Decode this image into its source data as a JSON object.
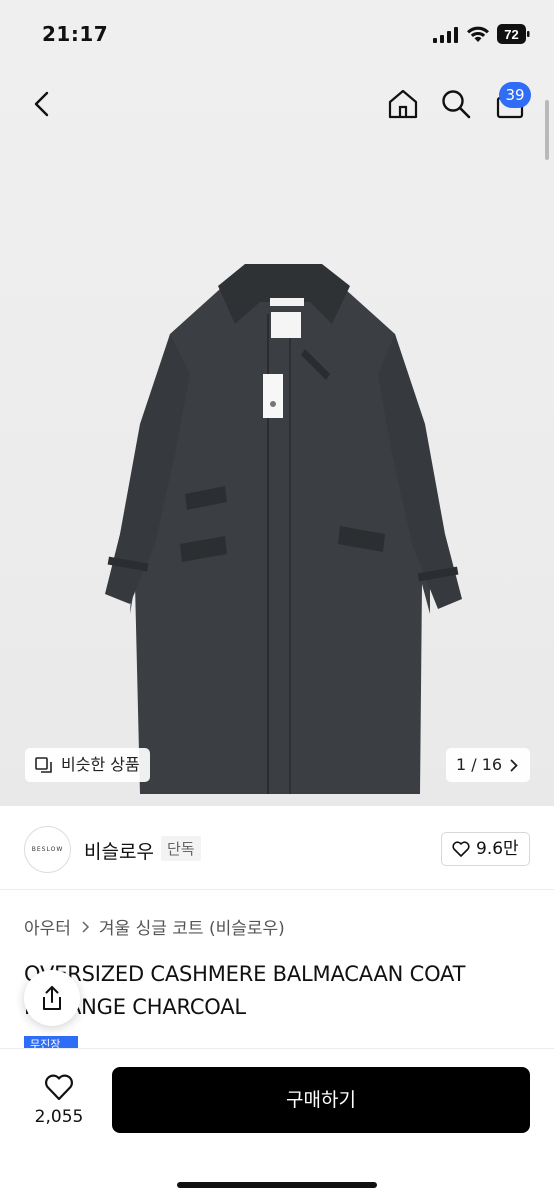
{
  "status_bar": {
    "time": "21:17",
    "battery": "72"
  },
  "header": {
    "cart_count": "39"
  },
  "gallery": {
    "similar_label": "비슷한 상품",
    "counter": "1 / 16",
    "coat_color": "#3a3d40"
  },
  "brand": {
    "name": "비슬로우",
    "tag": "단독",
    "likes": "9.6만",
    "logo_text": "BESLOW"
  },
  "breadcrumb": {
    "category": "아우터",
    "subcategory": "겨울 싱글 코트 (비슬로우)"
  },
  "product": {
    "title": "OVERSIZED CASHMERE BALMACAAN COAT MELANGE CHARCOAL",
    "badge": "무진장"
  },
  "bottom": {
    "wish_count": "2,055",
    "buy_label": "구매하기"
  },
  "colors": {
    "accent": "#2f6df6",
    "buy_button": "#000000"
  }
}
